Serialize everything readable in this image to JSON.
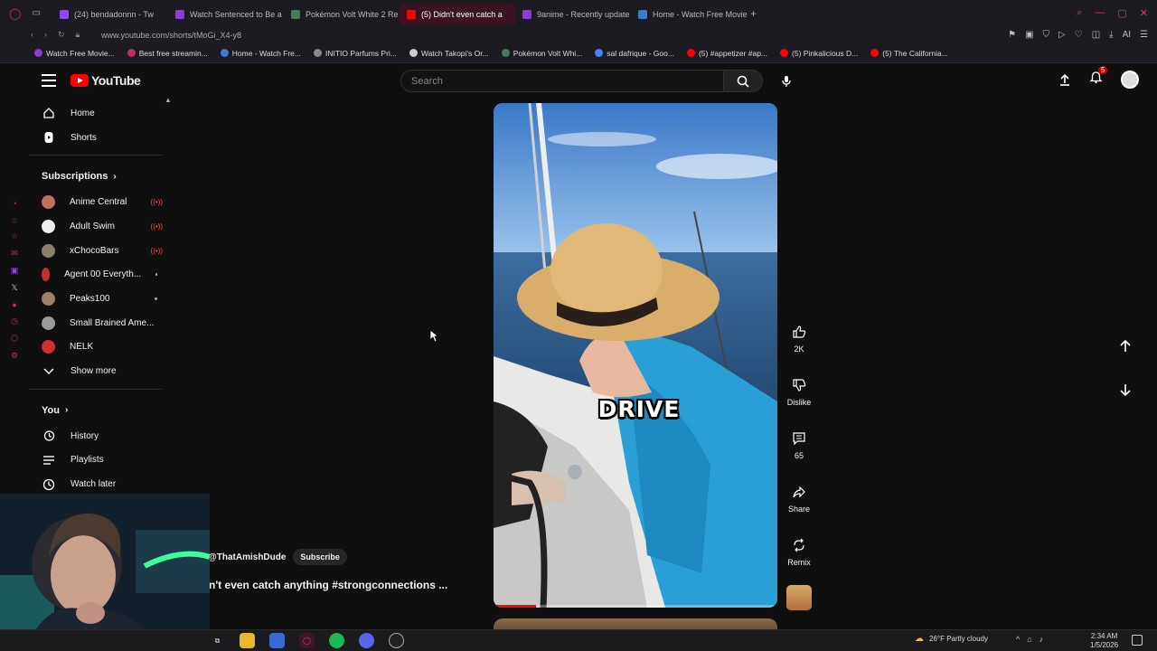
{
  "browser": {
    "tabs": [
      {
        "label": "(24) bendadonnn - Tw",
        "color": "#9146ff"
      },
      {
        "label": "Watch Sentenced to Be a",
        "color": "#8a3fd0"
      },
      {
        "label": "Pokémon Volt White 2 Re",
        "color": "#4a7a5a"
      },
      {
        "label": "(5) Didn't even catch a",
        "color": "#ff0000"
      },
      {
        "label": "9anime - Recently update",
        "color": "#8a3fd0"
      },
      {
        "label": "Home - Watch Free Movie",
        "color": "#3a7ad0"
      }
    ],
    "url": "www.youtube.com/shorts/tMoGi_X4-y8",
    "bookmarks": [
      {
        "label": "Watch Free Movie...",
        "color": "#8a3fd0"
      },
      {
        "label": "Best free streamin...",
        "color": "#c03060"
      },
      {
        "label": "Home - Watch Fre...",
        "color": "#3a7ad0"
      },
      {
        "label": "INITIO Parfums Pri...",
        "color": "#888888"
      },
      {
        "label": "Watch Takopi's Or...",
        "color": "#cccccc"
      },
      {
        "label": "Pokémon Volt Whi...",
        "color": "#4a7a5a"
      },
      {
        "label": "sal dafrique - Goo...",
        "color": "#4285f4"
      },
      {
        "label": "(5) #appetizer #ap...",
        "color": "#ff0000"
      },
      {
        "label": "(5) Pinkalicious D...",
        "color": "#ff0000"
      },
      {
        "label": "(5) The California...",
        "color": "#ff0000"
      }
    ]
  },
  "header": {
    "logo": "YouTube",
    "search_placeholder": "Search",
    "notification_count": "5"
  },
  "sidebar": {
    "home": "Home",
    "shorts": "Shorts",
    "subscriptions_heading": "Subscriptions",
    "subscriptions": [
      {
        "name": "Anime Central",
        "status": "live",
        "color": "#c07060"
      },
      {
        "name": "Adult Swim",
        "status": "live",
        "color": "#eeeeee"
      },
      {
        "name": "xChocoBars",
        "status": "live",
        "color": "#8a8070"
      },
      {
        "name": "Agent 00 Everyth...",
        "status": "new",
        "color": "#c03030"
      },
      {
        "name": "Peaks100",
        "status": "new",
        "color": "#a08060"
      },
      {
        "name": "Small Brained Ame...",
        "status": "none",
        "color": "#9a9a9a"
      },
      {
        "name": "NELK",
        "status": "none",
        "color": "#d03030"
      }
    ],
    "show_more": "Show more",
    "you_heading": "You",
    "history": "History",
    "playlists": "Playlists",
    "watch_later": "Watch later"
  },
  "short": {
    "overlay_text": "DRIVE",
    "channel": "@ThatAmishDude",
    "subscribe": "Subscribe",
    "title": "n't even catch anything #strongconnections ...",
    "progress": 0.15
  },
  "actions": {
    "likes": "2K",
    "dislike": "Dislike",
    "comments": "65",
    "share": "Share",
    "remix": "Remix"
  },
  "taskbar": {
    "weather": "26°F  Partly cloudy",
    "time": "2:34 AM",
    "date": "1/5/2026"
  }
}
